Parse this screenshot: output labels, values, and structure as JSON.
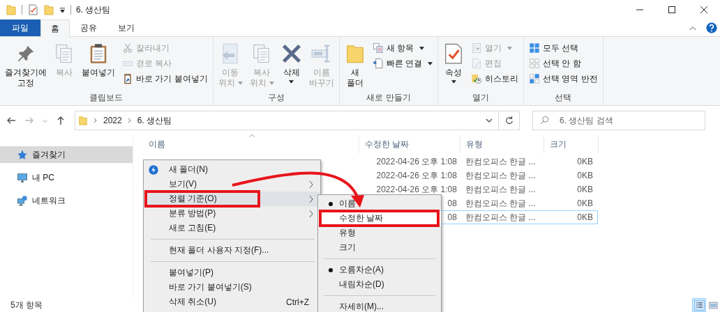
{
  "window": {
    "title": "6. 생산팀"
  },
  "ribbon_tabs": [
    {
      "label": "파일",
      "kind": "file",
      "selected": false
    },
    {
      "label": "홈",
      "kind": "tab",
      "selected": true
    },
    {
      "label": "공유",
      "kind": "tab",
      "selected": false
    },
    {
      "label": "보기",
      "kind": "tab",
      "selected": false
    }
  ],
  "ribbon_groups": [
    {
      "label": "클립보드",
      "items": [
        {
          "kind": "large",
          "label": "즐겨찾기에\n고정",
          "disabled": false
        },
        {
          "kind": "large",
          "label": "복사",
          "disabled": true
        },
        {
          "kind": "large",
          "label": "붙여넣기",
          "disabled": false
        },
        {
          "kind": "stack",
          "items": [
            {
              "label": "잘라내기",
              "disabled": true
            },
            {
              "label": "경로 복사",
              "disabled": true
            },
            {
              "label": "바로 가기 붙여넣기",
              "disabled": false
            }
          ]
        }
      ]
    },
    {
      "label": "구성",
      "items": [
        {
          "kind": "large",
          "label": "이동\n위치",
          "disabled": true,
          "dropdown": true
        },
        {
          "kind": "large",
          "label": "복사\n위치",
          "disabled": true,
          "dropdown": true
        },
        {
          "kind": "large",
          "label": "삭제",
          "disabled": false,
          "dropdown": true
        },
        {
          "kind": "large",
          "label": "이름\n바꾸기",
          "disabled": true
        }
      ]
    },
    {
      "label": "새로 만들기",
      "items": [
        {
          "kind": "large",
          "label": "새\n폴더",
          "disabled": false
        },
        {
          "kind": "stack",
          "items": [
            {
              "label": "새 항목",
              "disabled": false,
              "dropdown": true
            },
            {
              "label": "빠른 연결",
              "disabled": false,
              "dropdown": true
            }
          ]
        }
      ]
    },
    {
      "label": "열기",
      "items": [
        {
          "kind": "large",
          "label": "속성",
          "disabled": false,
          "dropdown": true
        },
        {
          "kind": "stack",
          "items": [
            {
              "label": "열기",
              "disabled": true,
              "dropdown": true
            },
            {
              "label": "편집",
              "disabled": true
            },
            {
              "label": "히스토리",
              "disabled": false
            }
          ]
        }
      ]
    },
    {
      "label": "선택",
      "items": [
        {
          "kind": "stack",
          "items": [
            {
              "label": "모두 선택",
              "disabled": false
            },
            {
              "label": "선택 안 함",
              "disabled": false
            },
            {
              "label": "선택 영역 반전",
              "disabled": false
            }
          ]
        }
      ]
    }
  ],
  "address": {
    "path": [
      "2022",
      "6. 생산팀"
    ]
  },
  "search": {
    "placeholder": "6. 생산팀 검색"
  },
  "nav": [
    {
      "label": "즐겨찾기",
      "selected": true
    },
    {
      "label": "내 PC",
      "selected": false
    },
    {
      "label": "네트워크",
      "selected": false
    }
  ],
  "table": {
    "columns": [
      "이름",
      "수정한 날짜",
      "유형",
      "크기"
    ],
    "rows": [
      {
        "date": "2022-04-26 오후 1:08",
        "type": "한컴오피스 한글 ...",
        "size": "0KB",
        "selected": false
      },
      {
        "date": "2022-04-26 오후 1:08",
        "type": "한컴오피스 한글 ...",
        "size": "0KB",
        "selected": false
      },
      {
        "date": "2022-04-26 오후 1:08",
        "type": "한컴오피스 한글 ...",
        "size": "0KB",
        "selected": false
      },
      {
        "date": "08",
        "type": "한컴오피스 한글 ...",
        "size": "0KB",
        "selected": false
      },
      {
        "date": "08",
        "type": "한컴오피스 한글 ...",
        "size": "0KB",
        "selected": true
      }
    ]
  },
  "context_menu": [
    {
      "kind": "item",
      "label": "새 폴더(N)",
      "submenu": false,
      "selected": false,
      "annotated": false
    },
    {
      "kind": "item",
      "label": "보기(V)",
      "submenu": true,
      "selected": false,
      "annotated": false
    },
    {
      "kind": "item",
      "label": "정렬 기준(O)",
      "submenu": true,
      "selected": true,
      "annotated": true
    },
    {
      "kind": "item",
      "label": "분류 방법(P)",
      "submenu": true,
      "selected": false,
      "annotated": false
    },
    {
      "kind": "item",
      "label": "새로 고침(E)",
      "submenu": false,
      "selected": false,
      "annotated": false
    },
    {
      "kind": "separator"
    },
    {
      "kind": "item",
      "label": "현재 폴더 사용자 지정(F)...",
      "submenu": false,
      "selected": false,
      "annotated": false
    },
    {
      "kind": "separator"
    },
    {
      "kind": "item",
      "label": "붙여넣기(P)",
      "submenu": false,
      "selected": false,
      "annotated": false
    },
    {
      "kind": "item",
      "label": "바로 가기 붙여넣기(S)",
      "submenu": false,
      "selected": false,
      "annotated": false
    },
    {
      "kind": "item",
      "label": "삭제 취소(U)",
      "shortcut": "Ctrl+Z",
      "submenu": false,
      "selected": false,
      "annotated": false
    }
  ],
  "sort_submenu": [
    {
      "kind": "item",
      "label": "이름",
      "checked": true,
      "selected": false,
      "annotated": false
    },
    {
      "kind": "item",
      "label": "수정한 날짜",
      "checked": false,
      "selected": true,
      "annotated": true
    },
    {
      "kind": "item",
      "label": "유형",
      "checked": false,
      "selected": false,
      "annotated": false
    },
    {
      "kind": "item",
      "label": "크기",
      "checked": false,
      "selected": false,
      "annotated": false
    },
    {
      "kind": "separator"
    },
    {
      "kind": "item",
      "label": "오름차순(A)",
      "checked": true,
      "selected": false,
      "annotated": false
    },
    {
      "kind": "item",
      "label": "내림차순(D)",
      "checked": false,
      "selected": false,
      "annotated": false
    },
    {
      "kind": "separator"
    },
    {
      "kind": "item",
      "label": "자세히(M)...",
      "checked": false,
      "selected": false,
      "annotated": false
    }
  ],
  "status_bar": {
    "count": "5개 항목"
  },
  "view_buttons": [
    {
      "selected": true
    },
    {
      "selected": false
    }
  ]
}
